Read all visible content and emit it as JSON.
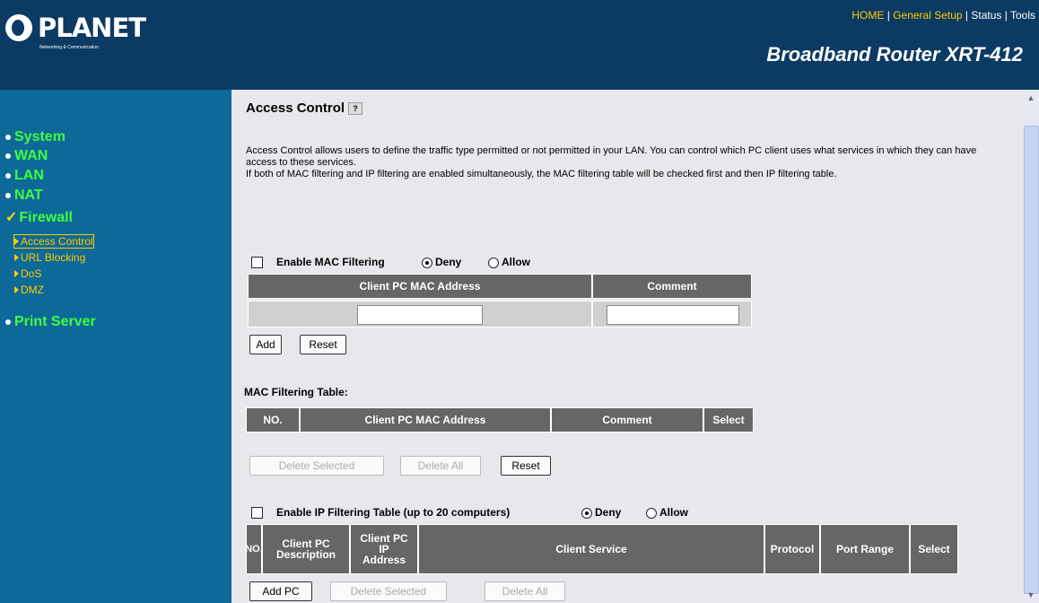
{
  "header": {
    "logo_brand": "PLANET",
    "logo_tagline": "Networking & Communication",
    "nav": [
      "HOME",
      "General Setup",
      "Status",
      "Tools"
    ],
    "nav_sep": " | ",
    "product": "Broadband Router XRT-412"
  },
  "sidebar": {
    "items": [
      {
        "label": "System"
      },
      {
        "label": "WAN"
      },
      {
        "label": "LAN"
      },
      {
        "label": "NAT"
      },
      {
        "label": "Firewall"
      },
      {
        "label": "Print Server"
      }
    ],
    "firewall_check": "✓",
    "subitems": [
      {
        "label": "Access Control"
      },
      {
        "label": "URL Blocking"
      },
      {
        "label": "DoS"
      },
      {
        "label": "DMZ"
      }
    ]
  },
  "main": {
    "title": "Access Control",
    "help": "?",
    "desc1": "Access Control allows users to define the traffic type permitted or not permitted in your LAN. You can control which PC client uses what services in which they can have access to these services.",
    "desc2": "If both of MAC filtering and IP filtering are enabled simultaneously, the MAC filtering table will be checked first and then IP filtering table.",
    "mac": {
      "enable_label": "Enable MAC Filtering",
      "deny": "Deny",
      "allow": "Allow",
      "col_mac": "Client PC MAC Address",
      "col_comment": "Comment",
      "add": "Add",
      "reset": "Reset"
    },
    "mac_table": {
      "title": "MAC Filtering Table:",
      "col_no": "NO.",
      "col_mac": "Client PC MAC Address",
      "col_comment": "Comment",
      "col_select": "Select",
      "delete_selected": "Delete Selected",
      "delete_all": "Delete All",
      "reset": "Reset"
    },
    "ip": {
      "enable_label": "Enable IP Filtering Table (up to 20 computers)",
      "deny": "Deny",
      "allow": "Allow",
      "col_no": "NO.",
      "col_desc_1": "Client PC",
      "col_desc_2": "Description",
      "col_ip_1": "Client PC",
      "col_ip_2": "IP",
      "col_ip_3": "Address",
      "col_service": "Client Service",
      "col_protocol": "Protocol",
      "col_port": "Port Range",
      "col_select": "Select",
      "add_pc": "Add PC",
      "delete_selected": "Delete Selected",
      "delete_all": "Delete All"
    }
  }
}
